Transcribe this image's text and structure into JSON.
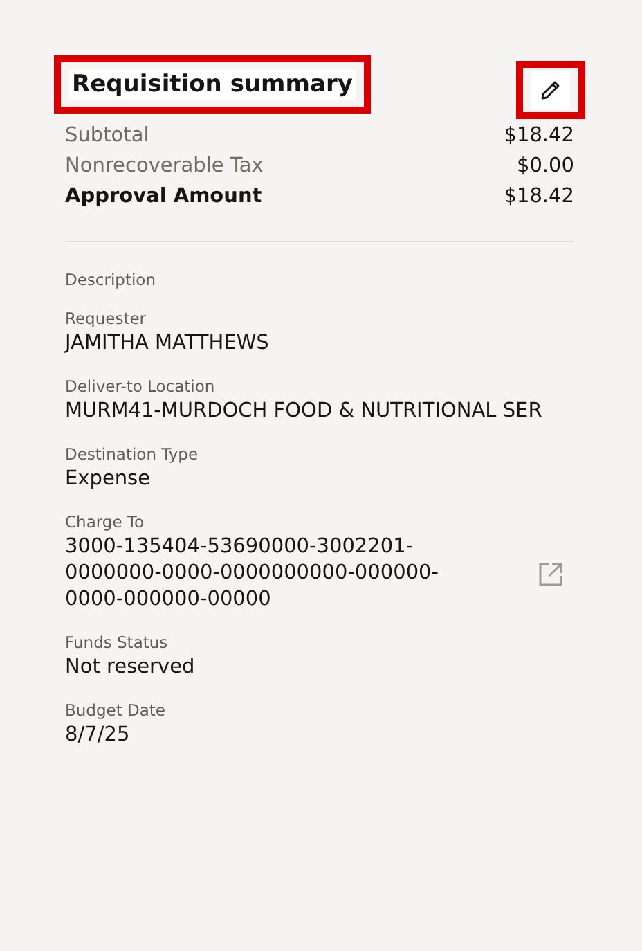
{
  "title": {
    "text": "Requisition summary",
    "highlighted": true
  },
  "edit_button": {
    "highlighted": true
  },
  "totals": [
    {
      "label": "Subtotal",
      "value": "$18.42",
      "emphasis": false
    },
    {
      "label": "Nonrecoverable Tax",
      "value": "$0.00",
      "emphasis": false
    },
    {
      "label": "Approval Amount",
      "value": "$18.42",
      "emphasis": true
    }
  ],
  "fields": [
    {
      "label": "Description"
    },
    {
      "label": "Requester",
      "value": "JAMITHA MATTHEWS",
      "link": false
    },
    {
      "label": "Deliver-to Location",
      "value": "MURM41-MURDOCH FOOD & NUTRITIONAL SER",
      "link": false
    },
    {
      "label": "Destination Type",
      "value": "Expense",
      "link": false
    },
    {
      "label": "Charge To",
      "value": "3000-135404-53690000-3002201-0000000-0000-0000000000-000000-0000-000000-00000",
      "link": true
    },
    {
      "label": "Funds Status",
      "value": "Not reserved",
      "link": false
    },
    {
      "label": "Budget Date",
      "value": "8/7/25",
      "link": false
    }
  ]
}
